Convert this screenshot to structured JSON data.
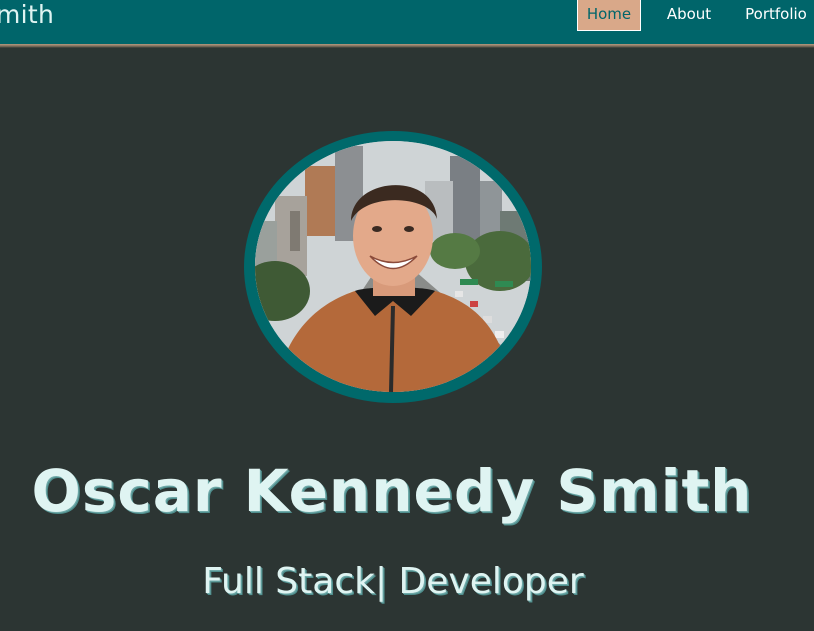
{
  "navbar": {
    "brand": "mith",
    "links": [
      {
        "label": "Home",
        "active": true
      },
      {
        "label": "About",
        "active": false
      },
      {
        "label": "Portfolio",
        "active": false
      }
    ]
  },
  "hero": {
    "name": "Oscar Kennedy Smith",
    "role": "Full Stack| Developer"
  },
  "colors": {
    "navbar": "#00656a",
    "background": "#2c3533",
    "active_tab": "#d9a889",
    "heading_text": "#dff4f2",
    "avatar_ring": "#00696b"
  }
}
